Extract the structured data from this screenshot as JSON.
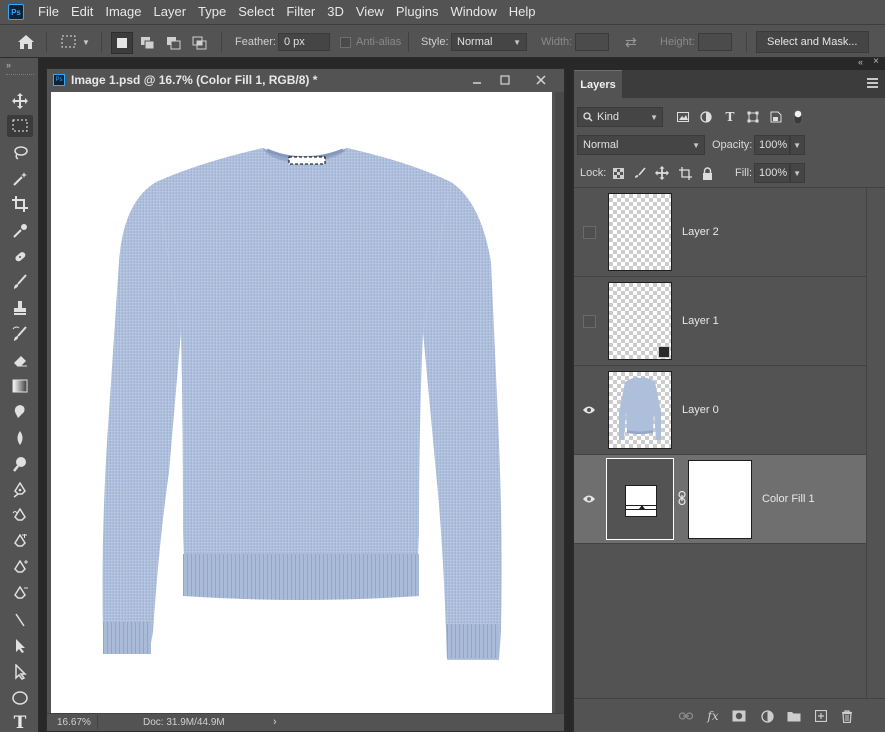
{
  "menubar": {
    "logo": "Ps",
    "items": [
      "File",
      "Edit",
      "Image",
      "Layer",
      "Type",
      "Select",
      "Filter",
      "3D",
      "View",
      "Plugins",
      "Window",
      "Help"
    ]
  },
  "options": {
    "feather_label": "Feather:",
    "feather_value": "0 px",
    "antialias_label": "Anti-alias",
    "style_label": "Style:",
    "style_value": "Normal",
    "width_label": "Width:",
    "height_label": "Height:",
    "select_mask_label": "Select and Mask..."
  },
  "document": {
    "title": "Image 1.psd @ 16.7% (Color Fill 1, RGB/8) *",
    "zoom": "16.67%",
    "doc_size": "Doc: 31.9M/44.9M"
  },
  "layers_panel": {
    "tab_label": "Layers",
    "filter_value": "Kind",
    "blend_mode": "Normal",
    "opacity_label": "Opacity:",
    "opacity_value": "100%",
    "lock_label": "Lock:",
    "fill_label": "Fill:",
    "fill_value": "100%",
    "layers": [
      {
        "name": "Layer 2",
        "visible": false
      },
      {
        "name": "Layer 1",
        "visible": false
      },
      {
        "name": "Layer 0",
        "visible": true
      },
      {
        "name": "Color Fill 1",
        "visible": true
      }
    ]
  },
  "colors": {
    "panel_bg": "#535353",
    "workspace_bg": "#282828",
    "selected_layer": "#6f6f6f",
    "sweater": "#b3c3de"
  },
  "icons": {
    "toolbar": [
      "move-icon",
      "marquee-icon",
      "lasso-icon",
      "magic-wand-icon",
      "crop-icon",
      "eyedropper-icon",
      "healing-brush-icon",
      "brush-icon",
      "clone-stamp-icon",
      "history-brush-icon",
      "eraser-icon",
      "gradient-icon",
      "blur-icon",
      "dodge-icon",
      "smudge-icon",
      "pen-icon",
      "freeform-pen-icon",
      "curvature-pen-icon",
      "add-anchor-icon",
      "delete-anchor-icon",
      "path-select-icon",
      "direct-select-icon",
      "ellipse-icon",
      "type-icon"
    ]
  }
}
